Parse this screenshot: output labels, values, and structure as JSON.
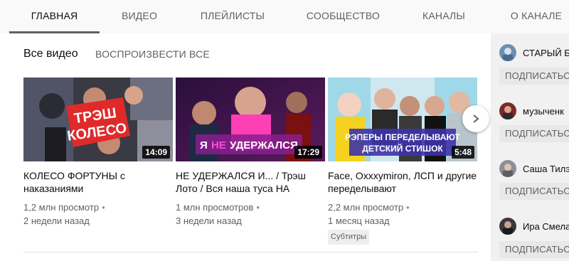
{
  "tabs": [
    {
      "label": "ГЛАВНАЯ",
      "active": true
    },
    {
      "label": "ВИДЕО"
    },
    {
      "label": "ПЛЕЙЛИСТЫ"
    },
    {
      "label": "СООБЩЕСТВО"
    },
    {
      "label": "КАНАЛЫ"
    },
    {
      "label": "О КАНАЛЕ"
    }
  ],
  "section": {
    "title": "Все видео",
    "play_all": "ВОСПРОИЗВЕСТИ ВСЕ"
  },
  "videos": [
    {
      "thumb_text": "ТРЭШ\nКОЛЕСО",
      "duration": "14:09",
      "title": "КОЛЕСО ФОРТУНЫ с наказаниями",
      "views": "1,2 млн просмотр",
      "age": "2 недели назад"
    },
    {
      "thumb_text": "Я НЕ УДЕРЖАЛСЯ",
      "duration": "17:29",
      "title": "НЕ УДЕРЖАЛСЯ И... / Трэш Лото / Вся наша туса НА",
      "views": "1 млн просмотров",
      "age": "3 недели назад"
    },
    {
      "thumb_text": "РЭПЕРЫ ПЕРЕДЕЛЫВАЮТ ДЕТСКИЙ СТИШОК",
      "duration": "5:48",
      "title": "Face, Oxxxymiron, ЛСП и другие переделывают",
      "views": "2,2 млн просмотр",
      "age": "1 месяц назад",
      "badge": "Субтитры"
    }
  ],
  "channels": [
    {
      "name": "СТАРЫЙ Б",
      "subscribe": "ПОДПИСАТЬС"
    },
    {
      "name": "музыченк",
      "subscribe": "ПОДПИСАТЬС"
    },
    {
      "name": "Саша Тилэ",
      "subscribe": "ПОДПИСАТЬС"
    },
    {
      "name": "Ира Смела",
      "subscribe": "ПОДПИСАТЬС"
    }
  ],
  "icons": {
    "next": "chevron-right-icon",
    "dots": "more-dots"
  },
  "colors": {
    "tab_text": "#606060",
    "active_text": "#0d0d0d",
    "subscribe_bg": "#e8e8e8"
  }
}
